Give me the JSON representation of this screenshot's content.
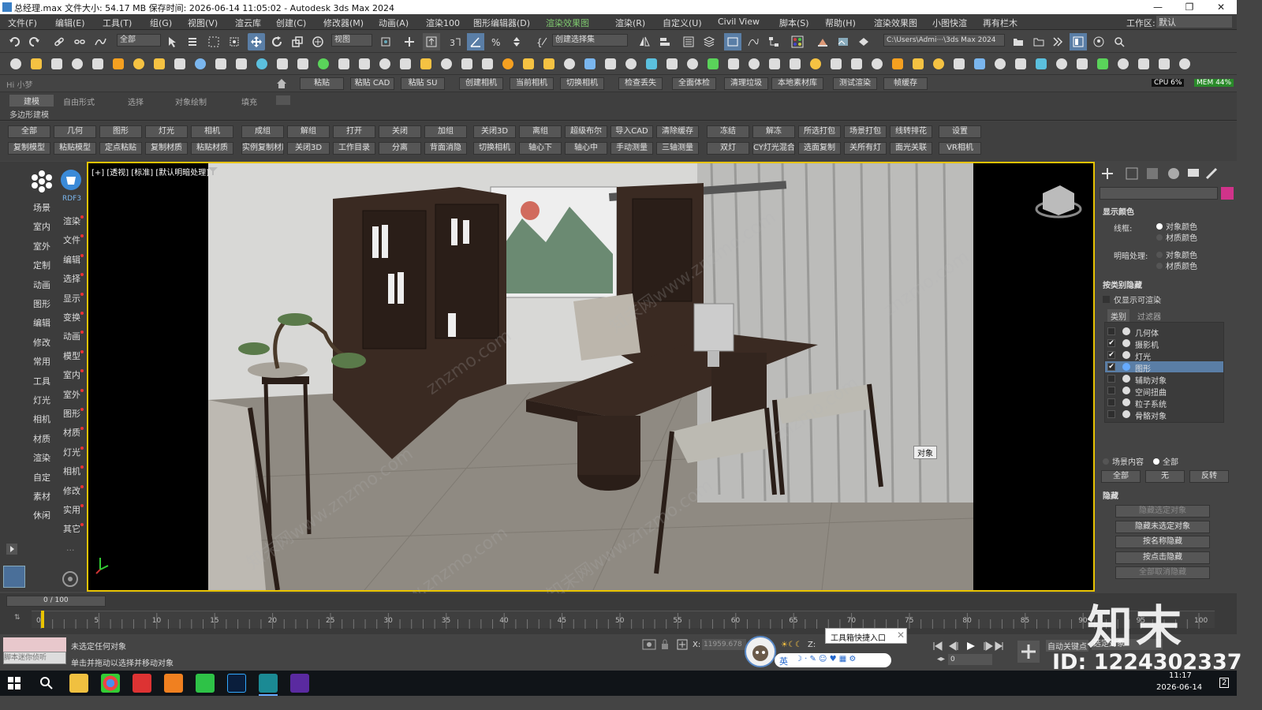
{
  "window": {
    "title": "总经理.max  文件大小: 54.17 MB  保存时间: 2026-06-14 11:05:02 - Autodesk 3ds Max 2024",
    "minimize": "—",
    "maximize": "❐",
    "close": "✕"
  },
  "menu": {
    "items": [
      "文件(F)",
      "编辑(E)",
      "工具(T)",
      "组(G)",
      "视图(V)",
      "渲云库",
      "创建(C)",
      "修改器(M)",
      "动画(A)",
      "渲染100",
      "图形编辑器(D)",
      "渲染效果图",
      "渲染(R)",
      "自定义(U)",
      "Civil View",
      "脚本(S)",
      "帮助(H)",
      "渲染效果图",
      "小图快渲",
      "再有栏木"
    ],
    "workspace_label": "工作区:",
    "workspace_value": "默认"
  },
  "toolbar1": {
    "selection_filter": "全部",
    "view_dropdown": "视图",
    "selection_set": "创建选择集",
    "project_path": "C:\\Users\\Admi···\\3ds Max 2024"
  },
  "toolbar3": {
    "user": "Hi 小梦",
    "buttons": [
      "粘贴",
      "粘贴 CAD",
      "粘贴 SU",
      "创建相机",
      "当前相机",
      "切换相机",
      "检查丢失",
      "全面体检",
      "清理垃圾",
      "本地素材库",
      "测试渲染",
      "帧缓存"
    ],
    "cpu": "CPU 6%",
    "mem": "MEM 44%"
  },
  "ribbon": {
    "tabs": [
      "建模",
      "自由形式",
      "选择",
      "对象绘制",
      "填充"
    ],
    "sub_label": "多边形建模"
  },
  "quick_tools": {
    "row1": [
      "全部",
      "几何",
      "图形",
      "灯光",
      "相机",
      "成组",
      "解组",
      "打开",
      "关闭",
      "加组",
      "关闭3D",
      "离组",
      "超级布尔",
      "导入CAD",
      "清除缓存",
      "冻结",
      "解冻",
      "所选打包",
      "场景打包",
      "线转排花",
      "设置"
    ],
    "row2": [
      "复制模型",
      "粘贴模型",
      "定点粘贴",
      "复制材质",
      "粘贴材质",
      "实例复制材质",
      "关闭3D",
      "工作目录",
      "分离",
      "背面消隐",
      "切换相机",
      "轴心下",
      "轴心中",
      "手动测量",
      "三轴测量",
      "双灯",
      "CY灯光混合",
      "选面复制",
      "关所有灯",
      "面光关联",
      "VR相机"
    ]
  },
  "left_panel": {
    "col1": [
      "场景",
      "室内",
      "室外",
      "定制",
      "动画",
      "图形",
      "编辑",
      "修改",
      "常用",
      "工具",
      "灯光",
      "相机",
      "材质",
      "渲染",
      "自定",
      "素材",
      "休闲"
    ],
    "col2_top": "RDF3",
    "col2": [
      "渲染",
      "文件",
      "编辑",
      "选择",
      "显示",
      "变换",
      "动画",
      "模型",
      "室内",
      "室外",
      "图形",
      "材质",
      "灯光",
      "相机",
      "修改",
      "实用",
      "其它"
    ],
    "more": "···"
  },
  "viewport": {
    "label": "[+] [透视] [标准] [默认明暗处理]",
    "tooltip": "对象"
  },
  "right_panel": {
    "display_color": "显示颜色",
    "wireframe_label": "线框:",
    "shaded_label": "明暗处理:",
    "opt_object_color": "对象颜色",
    "opt_material_color": "材质颜色",
    "hide_by_category": "按类别隐藏",
    "only_renderable": "仅显示可渲染",
    "tab_category": "类别",
    "tab_filter": "过滤器",
    "categories": [
      "几何体",
      "摄影机",
      "灯光",
      "图形",
      "辅助对象",
      "空间扭曲",
      "粒子系统",
      "骨骼对象"
    ],
    "scene_content": "场景内容",
    "all": "全部",
    "btn_all": "全部",
    "btn_none": "无",
    "btn_invert": "反转",
    "hide_section": "隐藏",
    "hide_buttons": [
      "隐藏选定对象",
      "隐藏未选定对象",
      "按名称隐藏",
      "按点击隐藏",
      "全部取消隐藏"
    ]
  },
  "timeline": {
    "frame_counter": "0 / 100",
    "ticks": [
      "0",
      "5",
      "10",
      "15",
      "20",
      "25",
      "30",
      "35",
      "40",
      "45",
      "50",
      "55",
      "60",
      "65",
      "70",
      "75",
      "80",
      "85",
      "90",
      "95",
      "100"
    ]
  },
  "status": {
    "script_placeholder": "脚本迷你侦听",
    "line1": "未选定任何对象",
    "line2": "单击并拖动以选择并移动对象",
    "x_label": "X:",
    "x_value": "11959.678",
    "z_label": "Z:",
    "tools_popup": "工具箱快捷入口",
    "auto_key": "自动关键点",
    "selected_obj": "选定对象",
    "frame_field": "0",
    "ime": "英"
  },
  "taskbar": {
    "time": "11:17",
    "date": "2026-06-14",
    "badge": "2"
  },
  "watermark": {
    "brand": "知末",
    "id": "ID: 1224302337",
    "site": "znzmo.com",
    "cn": "知末网www.znzmo.com"
  }
}
